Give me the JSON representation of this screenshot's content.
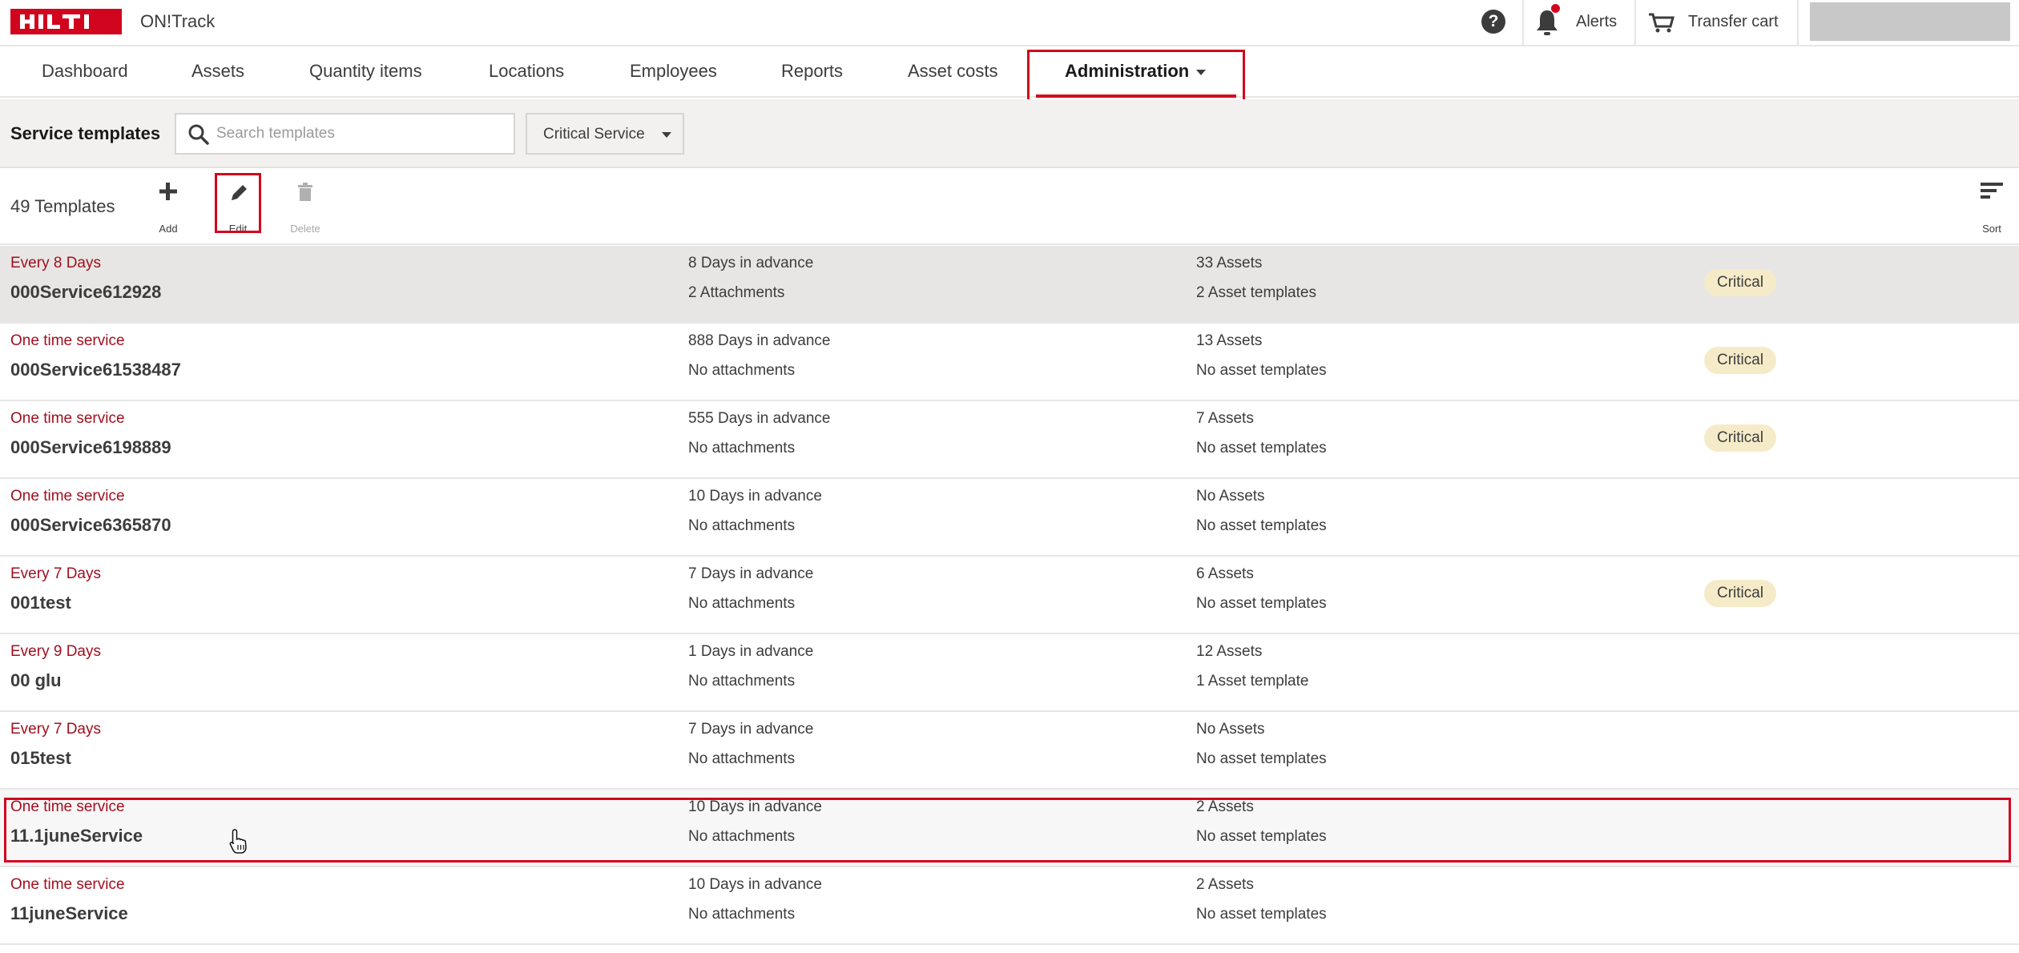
{
  "header": {
    "logo_text": "HILTI",
    "app_name": "ON!Track",
    "help_glyph": "?",
    "alerts_label": "Alerts",
    "cart_label": "Transfer cart",
    "brand_color": "#d2051e"
  },
  "nav": {
    "tabs": [
      {
        "label": "Dashboard"
      },
      {
        "label": "Assets"
      },
      {
        "label": "Quantity items"
      },
      {
        "label": "Locations"
      },
      {
        "label": "Employees"
      },
      {
        "label": "Reports"
      },
      {
        "label": "Asset costs"
      },
      {
        "label": "Administration"
      }
    ],
    "active_tab": "Administration"
  },
  "filter": {
    "title": "Service templates",
    "search_placeholder": "Search templates",
    "select_value": "Critical Service"
  },
  "toolbar": {
    "count": "49 Templates",
    "add_label": "Add",
    "edit_label": "Edit",
    "delete_label": "Delete",
    "sort_label": "Sort"
  },
  "rows": [
    {
      "interval": "Every 8 Days",
      "name": "000Service612928",
      "advance": "8 Days in advance",
      "attachments": "2 Attachments",
      "assets": "33 Assets",
      "templates": "2 Asset templates",
      "badge": "Critical"
    },
    {
      "interval": "One time service",
      "name": "000Service61538487",
      "advance": "888 Days in advance",
      "attachments": "No attachments",
      "assets": "13 Assets",
      "templates": "No asset templates",
      "badge": "Critical"
    },
    {
      "interval": "One time service",
      "name": "000Service6198889",
      "advance": "555 Days in advance",
      "attachments": "No attachments",
      "assets": "7 Assets",
      "templates": "No asset templates",
      "badge": "Critical"
    },
    {
      "interval": "One time service",
      "name": "000Service6365870",
      "advance": "10 Days in advance",
      "attachments": "No attachments",
      "assets": "No Assets",
      "templates": "No asset templates",
      "badge": ""
    },
    {
      "interval": "Every 7 Days",
      "name": "001test",
      "advance": "7 Days in advance",
      "attachments": "No attachments",
      "assets": "6 Assets",
      "templates": "No asset templates",
      "badge": "Critical"
    },
    {
      "interval": "Every 9 Days",
      "name": "00 glu",
      "advance": "1 Days in advance",
      "attachments": "No attachments",
      "assets": "12 Assets",
      "templates": "1 Asset template",
      "badge": ""
    },
    {
      "interval": "Every 7 Days",
      "name": "015test",
      "advance": "7 Days in advance",
      "attachments": "No attachments",
      "assets": "No Assets",
      "templates": "No asset templates",
      "badge": ""
    },
    {
      "interval": "One time service",
      "name": "11.1juneService",
      "advance": "10 Days in advance",
      "attachments": "No attachments",
      "assets": "2 Assets",
      "templates": "No asset templates",
      "badge": ""
    },
    {
      "interval": "One time service",
      "name": "11juneService",
      "advance": "10 Days in advance",
      "attachments": "No attachments",
      "assets": "2 Assets",
      "templates": "No asset templates",
      "badge": ""
    }
  ]
}
